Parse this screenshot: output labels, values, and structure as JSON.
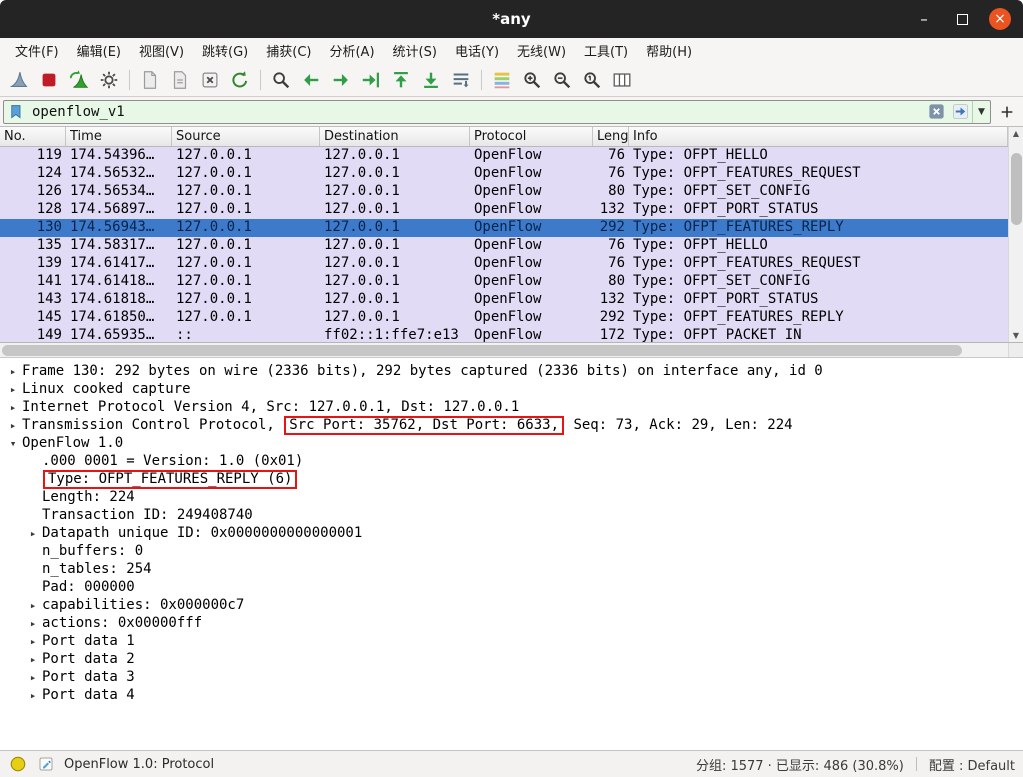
{
  "window": {
    "title": "*any"
  },
  "menu_bar": {
    "items": [
      "文件(F)",
      "编辑(E)",
      "视图(V)",
      "跳转(G)",
      "捕获(C)",
      "分析(A)",
      "统计(S)",
      "电话(Y)",
      "无线(W)",
      "工具(T)",
      "帮助(H)"
    ]
  },
  "toolbar": {
    "icons": [
      "capture-start",
      "capture-stop",
      "capture-restart",
      "capture-options",
      "open-file",
      "save-file",
      "close-file",
      "reload",
      "find-packet",
      "previous-packet",
      "next-packet",
      "go-to-packet",
      "first-packet",
      "last-packet",
      "auto-scroll",
      "colorize-packets",
      "zoom-in",
      "zoom-out",
      "zoom-original",
      "resize-columns"
    ]
  },
  "filter_bar": {
    "value": "openflow_v1"
  },
  "packet_list": {
    "columns": [
      "No.",
      "Time",
      "Source",
      "Destination",
      "Protocol",
      "Length",
      "Info"
    ],
    "rows": [
      {
        "no": "119",
        "time": "174.54396…",
        "source": "127.0.0.1",
        "destination": "127.0.0.1",
        "protocol": "OpenFlow",
        "length": "76",
        "info": "Type: OFPT_HELLO",
        "selected": false
      },
      {
        "no": "124",
        "time": "174.56532…",
        "source": "127.0.0.1",
        "destination": "127.0.0.1",
        "protocol": "OpenFlow",
        "length": "76",
        "info": "Type: OFPT_FEATURES_REQUEST",
        "selected": false
      },
      {
        "no": "126",
        "time": "174.56534…",
        "source": "127.0.0.1",
        "destination": "127.0.0.1",
        "protocol": "OpenFlow",
        "length": "80",
        "info": "Type: OFPT_SET_CONFIG",
        "selected": false
      },
      {
        "no": "128",
        "time": "174.56897…",
        "source": "127.0.0.1",
        "destination": "127.0.0.1",
        "protocol": "OpenFlow",
        "length": "132",
        "info": "Type: OFPT_PORT_STATUS",
        "selected": false
      },
      {
        "no": "130",
        "time": "174.56943…",
        "source": "127.0.0.1",
        "destination": "127.0.0.1",
        "protocol": "OpenFlow",
        "length": "292",
        "info": "Type: OFPT_FEATURES_REPLY",
        "selected": true
      },
      {
        "no": "135",
        "time": "174.58317…",
        "source": "127.0.0.1",
        "destination": "127.0.0.1",
        "protocol": "OpenFlow",
        "length": "76",
        "info": "Type: OFPT_HELLO",
        "selected": false
      },
      {
        "no": "139",
        "time": "174.61417…",
        "source": "127.0.0.1",
        "destination": "127.0.0.1",
        "protocol": "OpenFlow",
        "length": "76",
        "info": "Type: OFPT_FEATURES_REQUEST",
        "selected": false
      },
      {
        "no": "141",
        "time": "174.61418…",
        "source": "127.0.0.1",
        "destination": "127.0.0.1",
        "protocol": "OpenFlow",
        "length": "80",
        "info": "Type: OFPT_SET_CONFIG",
        "selected": false
      },
      {
        "no": "143",
        "time": "174.61818…",
        "source": "127.0.0.1",
        "destination": "127.0.0.1",
        "protocol": "OpenFlow",
        "length": "132",
        "info": "Type: OFPT_PORT_STATUS",
        "selected": false
      },
      {
        "no": "145",
        "time": "174.61850…",
        "source": "127.0.0.1",
        "destination": "127.0.0.1",
        "protocol": "OpenFlow",
        "length": "292",
        "info": "Type: OFPT_FEATURES_REPLY",
        "selected": false
      },
      {
        "no": "149",
        "time": "174.65935…",
        "source": "::",
        "destination": "ff02::1:ffe7:e13",
        "protocol": "OpenFlow",
        "length": "172",
        "info": "Type: OFPT_PACKET_IN",
        "selected": false
      }
    ]
  },
  "details": {
    "lines": [
      {
        "indent": 0,
        "expander": "right",
        "segments": [
          {
            "text": "Frame 130: 292 bytes on wire (2336 bits), 292 bytes captured (2336 bits) on interface any, id 0"
          }
        ]
      },
      {
        "indent": 0,
        "expander": "right",
        "segments": [
          {
            "text": "Linux cooked capture"
          }
        ]
      },
      {
        "indent": 0,
        "expander": "right",
        "segments": [
          {
            "text": "Internet Protocol Version 4, Src: 127.0.0.1, Dst: 127.0.0.1"
          }
        ]
      },
      {
        "indent": 0,
        "expander": "right",
        "segments": [
          {
            "text": "Transmission Control Protocol, "
          },
          {
            "text": "Src Port: 35762, Dst Port: 6633,",
            "highlight": true
          },
          {
            "text": " Seq: 73, Ack: 29, Len: 224"
          }
        ]
      },
      {
        "indent": 0,
        "expander": "down",
        "segments": [
          {
            "text": "OpenFlow 1.0"
          }
        ]
      },
      {
        "indent": 1,
        "expander": "none",
        "segments": [
          {
            "text": ".000 0001 = Version: 1.0 (0x01)"
          }
        ]
      },
      {
        "indent": 1,
        "expander": "none",
        "segments": [
          {
            "text": "Type: OFPT_FEATURES_REPLY (6)",
            "highlight": true
          }
        ]
      },
      {
        "indent": 1,
        "expander": "none",
        "segments": [
          {
            "text": "Length: 224"
          }
        ]
      },
      {
        "indent": 1,
        "expander": "none",
        "segments": [
          {
            "text": "Transaction ID: 249408740"
          }
        ]
      },
      {
        "indent": 1,
        "expander": "right",
        "segments": [
          {
            "text": "Datapath unique ID: 0x0000000000000001"
          }
        ]
      },
      {
        "indent": 1,
        "expander": "none",
        "segments": [
          {
            "text": "n_buffers: 0"
          }
        ]
      },
      {
        "indent": 1,
        "expander": "none",
        "segments": [
          {
            "text": "n_tables: 254"
          }
        ]
      },
      {
        "indent": 1,
        "expander": "none",
        "segments": [
          {
            "text": "Pad: 000000"
          }
        ]
      },
      {
        "indent": 1,
        "expander": "right",
        "segments": [
          {
            "text": "capabilities: 0x000000c7"
          }
        ]
      },
      {
        "indent": 1,
        "expander": "right",
        "segments": [
          {
            "text": "actions: 0x00000fff"
          }
        ]
      },
      {
        "indent": 1,
        "expander": "right",
        "segments": [
          {
            "text": "Port data 1"
          }
        ]
      },
      {
        "indent": 1,
        "expander": "right",
        "segments": [
          {
            "text": "Port data 2"
          }
        ]
      },
      {
        "indent": 1,
        "expander": "right",
        "segments": [
          {
            "text": "Port data 3"
          }
        ]
      },
      {
        "indent": 1,
        "expander": "right",
        "segments": [
          {
            "text": "Port data 4"
          }
        ]
      }
    ]
  },
  "status_bar": {
    "left_text": "OpenFlow 1.0: Protocol",
    "packets_text": "分组: 1577 · 已显示: 486 (30.8%)",
    "profile_text": "配置 : Default"
  },
  "colors": {
    "openflow_row_bg": "#e2dbf6",
    "selected_row_bg": "#3d7bca",
    "annotation_red": "#e81414",
    "titlebar_bg": "#242424",
    "close_button": "#e95420",
    "filter_valid_bg": "#e7f8e7"
  }
}
